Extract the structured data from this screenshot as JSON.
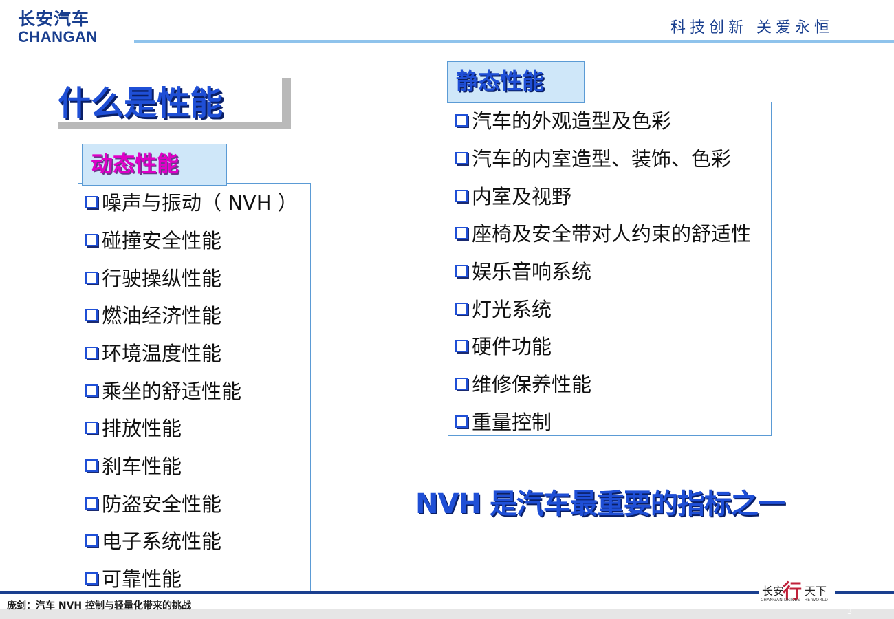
{
  "header": {
    "logo_cn": "长安汽车",
    "logo_en": "CHANGAN",
    "slogan": "科技创新 关爱永恒"
  },
  "main_title": "什么是性能",
  "dynamic": {
    "heading": "动态性能",
    "items": [
      "噪声与振动（ NVH ）",
      "碰撞安全性能",
      "行驶操纵性能",
      "燃油经济性能",
      "环境温度性能",
      "乘坐的舒适性能",
      "排放性能",
      "刹车性能",
      "防盗安全性能",
      "电子系统性能",
      "可靠性能"
    ]
  },
  "static": {
    "heading": "静态性能",
    "items": [
      "汽车的外观造型及色彩",
      "汽车的内室造型、装饰、色彩",
      "内室及视野",
      "座椅及安全带对人约束的舒适性",
      "娱乐音响系统",
      "灯光系统",
      "硬件功能",
      "维修保养性能",
      "重量控制"
    ]
  },
  "statement": "NVH 是汽车最重要的指标之一",
  "footer": {
    "text": "庞剑：汽车 NVH 控制与轻量化带来的挑战",
    "page": "3",
    "brand_cn_left": "长安",
    "brand_glyph": "行",
    "brand_cn_right": "天下",
    "brand_en": "CHANGAN DRIVES  THE WORLD"
  },
  "colors": {
    "title_blue": "#1f4fd6",
    "dynamic_magenta": "#e000c8",
    "box_border": "#5b9bd5",
    "header_line": "#8fc3ec",
    "brand_navy": "#1a3f8f"
  }
}
